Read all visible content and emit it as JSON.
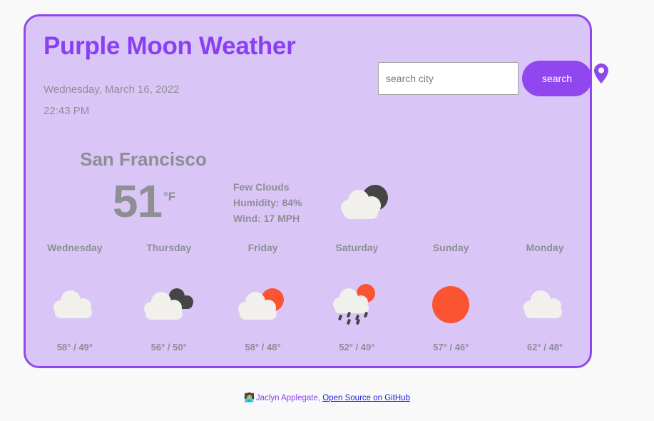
{
  "header": {
    "title": "Purple Moon Weather",
    "date": "Wednesday, March 16, 2022",
    "time": "22:43 PM"
  },
  "search": {
    "placeholder": "search city",
    "value": "",
    "button_label": "search",
    "pin_icon": "location-pin-icon"
  },
  "current": {
    "city": "San Francisco",
    "temperature": "51",
    "unit": "°F",
    "condition": "Few Clouds",
    "humidity": "Humidity: 84%",
    "wind": "Wind: 17 MPH",
    "icon": "cloud-with-moon-icon"
  },
  "forecast": [
    {
      "day": "Wednesday",
      "icon": "cloud-icon",
      "temps": "58° / 49°",
      "high": 58,
      "low": 49
    },
    {
      "day": "Thursday",
      "icon": "broken-clouds-icon",
      "temps": "56° / 50°",
      "high": 56,
      "low": 50
    },
    {
      "day": "Friday",
      "icon": "sun-behind-cloud-icon",
      "temps": "58° / 48°",
      "high": 58,
      "low": 48
    },
    {
      "day": "Saturday",
      "icon": "sun-rain-cloud-icon",
      "temps": "52° / 49°",
      "high": 52,
      "low": 49
    },
    {
      "day": "Sunday",
      "icon": "sun-icon",
      "temps": "57° / 46°",
      "high": 57,
      "low": 46
    },
    {
      "day": "Monday",
      "icon": "cloud-icon",
      "temps": "62° / 48°",
      "high": 62,
      "low": 48
    }
  ],
  "footer": {
    "emoji": "👩‍💻",
    "author": "Jaclyn Applegate,",
    "link_text": "Open Source on GitHub"
  },
  "colors": {
    "accent_purple": "#9147f0",
    "card_background": "#d9c6f7",
    "page_background": "#f9f9fa",
    "text_gray": "#8e8e95",
    "cloud_white": "#f2f0ec",
    "cloud_dark": "#454545",
    "sun_orange": "#fb5432",
    "link_blue": "#2222dd"
  }
}
